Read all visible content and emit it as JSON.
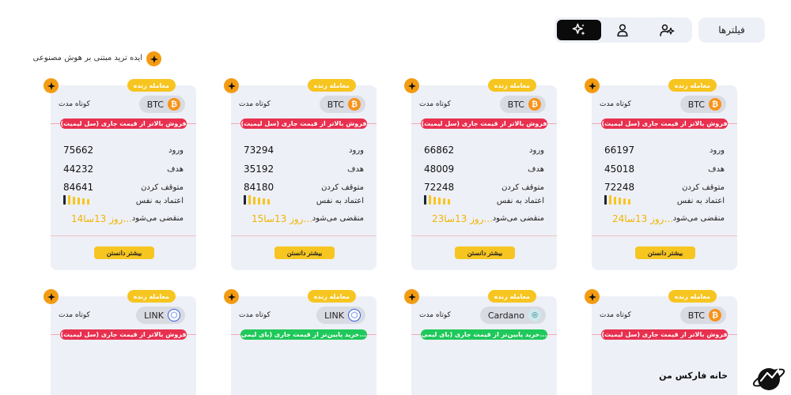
{
  "topbar": {
    "filters_label": "فیلترها"
  },
  "ai_section": {
    "label": "ایده ترید مبتنی بر هوش مصنوعی"
  },
  "labels": {
    "live": "معامله زنده",
    "term": "کوتاه مدت",
    "entry": "ورود",
    "target": "هدف",
    "stop": "متوقف کردن",
    "confidence": "اعتماد به نفس",
    "expires": "منقضی می‌شود",
    "more": "بیشتر دانستن"
  },
  "cards": [
    {
      "coin": "BTC",
      "signal": "فروش بالاتر از قیمت جاری (سل لیمیت)",
      "entry": "66197",
      "target": "45018",
      "stop": "72248",
      "confidence_bars": 1,
      "expire": "24روز 13سا..."
    },
    {
      "coin": "BTC",
      "signal": "فروش بالاتر از قیمت جاری (سل لیمیت)",
      "entry": "66862",
      "target": "48009",
      "stop": "72248",
      "confidence_bars": 1,
      "expire": "23روز 13سا..."
    },
    {
      "coin": "BTC",
      "signal": "فروش بالاتر از قیمت جاری (سل لیمیت)",
      "entry": "73294",
      "target": "35192",
      "stop": "84180",
      "confidence_bars": 1,
      "expire": "15روز 13سا..."
    },
    {
      "coin": "BTC",
      "signal": "فروش بالاتر از قیمت جاری (سل لیمیت)",
      "entry": "75662",
      "target": "44232",
      "stop": "84641",
      "confidence_bars": 1,
      "expire": "14روز 13سا..."
    },
    {
      "coin": "BTC",
      "signal": "فروش بالاتر از قیمت جاری (سل لیمیت)"
    },
    {
      "coin": "Cardano",
      "signal": "خرید پایین‌تر از قیمت جاری (بای لیمی..."
    },
    {
      "coin": "LINK",
      "signal": "خرید پایین‌تر از قیمت جاری (بای لیمی..."
    },
    {
      "coin": "LINK",
      "signal": "فروش بالاتر از قیمت جاری (سل لیمیت)"
    }
  ],
  "footer": {
    "brand": "خانه فارکس من"
  },
  "colors": {
    "accent": "#f7c520",
    "sell": "#e8304f",
    "buy": "#1fc85a",
    "card_bg": "#eef0f7"
  }
}
